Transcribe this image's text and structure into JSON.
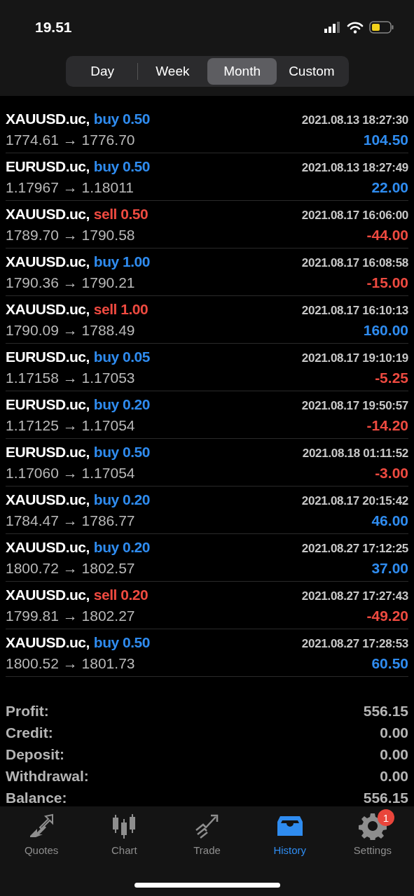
{
  "status_bar": {
    "time": "19.51"
  },
  "periods": [
    {
      "label": "Day",
      "selected": false
    },
    {
      "label": "Week",
      "selected": false
    },
    {
      "label": "Month",
      "selected": true
    },
    {
      "label": "Custom",
      "selected": false
    }
  ],
  "deals": [
    {
      "symbol": "XAUUSD.uc,",
      "side": "buy 0.50",
      "kind": "buy",
      "time": "2021.08.13 18:27:30",
      "prices": "1774.61 → 1776.70",
      "profit": "104.50",
      "loss": false
    },
    {
      "symbol": "EURUSD.uc,",
      "side": "buy 0.50",
      "kind": "buy",
      "time": "2021.08.13 18:27:49",
      "prices": "1.17967 → 1.18011",
      "profit": "22.00",
      "loss": false
    },
    {
      "symbol": "XAUUSD.uc,",
      "side": "sell 0.50",
      "kind": "sell",
      "time": "2021.08.17 16:06:00",
      "prices": "1789.70 → 1790.58",
      "profit": "-44.00",
      "loss": true
    },
    {
      "symbol": "XAUUSD.uc,",
      "side": "buy 1.00",
      "kind": "buy",
      "time": "2021.08.17 16:08:58",
      "prices": "1790.36 → 1790.21",
      "profit": "-15.00",
      "loss": true
    },
    {
      "symbol": "XAUUSD.uc,",
      "side": "sell 1.00",
      "kind": "sell",
      "time": "2021.08.17 16:10:13",
      "prices": "1790.09 → 1788.49",
      "profit": "160.00",
      "loss": false
    },
    {
      "symbol": "EURUSD.uc,",
      "side": "buy 0.05",
      "kind": "buy",
      "time": "2021.08.17 19:10:19",
      "prices": "1.17158 → 1.17053",
      "profit": "-5.25",
      "loss": true
    },
    {
      "symbol": "EURUSD.uc,",
      "side": "buy 0.20",
      "kind": "buy",
      "time": "2021.08.17 19:50:57",
      "prices": "1.17125 → 1.17054",
      "profit": "-14.20",
      "loss": true
    },
    {
      "symbol": "EURUSD.uc,",
      "side": "buy 0.50",
      "kind": "buy",
      "time": "2021.08.18 01:11:52",
      "prices": "1.17060 → 1.17054",
      "profit": "-3.00",
      "loss": true
    },
    {
      "symbol": "XAUUSD.uc,",
      "side": "buy 0.20",
      "kind": "buy",
      "time": "2021.08.17 20:15:42",
      "prices": "1784.47 → 1786.77",
      "profit": "46.00",
      "loss": false
    },
    {
      "symbol": "XAUUSD.uc,",
      "side": "buy 0.20",
      "kind": "buy",
      "time": "2021.08.27 17:12:25",
      "prices": "1800.72 → 1802.57",
      "profit": "37.00",
      "loss": false
    },
    {
      "symbol": "XAUUSD.uc,",
      "side": "sell 0.20",
      "kind": "sell",
      "time": "2021.08.27 17:27:43",
      "prices": "1799.81 → 1802.27",
      "profit": "-49.20",
      "loss": true
    },
    {
      "symbol": "XAUUSD.uc,",
      "side": "buy 0.50",
      "kind": "buy",
      "time": "2021.08.27 17:28:53",
      "prices": "1800.52 → 1801.73",
      "profit": "60.50",
      "loss": false
    }
  ],
  "summary": [
    {
      "label": "Profit:",
      "value": "556.15"
    },
    {
      "label": "Credit:",
      "value": "0.00"
    },
    {
      "label": "Deposit:",
      "value": "0.00"
    },
    {
      "label": "Withdrawal:",
      "value": "0.00"
    },
    {
      "label": "Balance:",
      "value": "556.15"
    }
  ],
  "tab_bar": [
    {
      "label": "Quotes",
      "kind": "quotes",
      "selected": false
    },
    {
      "label": "Chart",
      "kind": "chart",
      "selected": false
    },
    {
      "label": "Trade",
      "kind": "trade",
      "selected": false
    },
    {
      "label": "History",
      "kind": "history",
      "selected": true
    },
    {
      "label": "Settings",
      "kind": "settings",
      "selected": false,
      "badge": "1"
    }
  ]
}
